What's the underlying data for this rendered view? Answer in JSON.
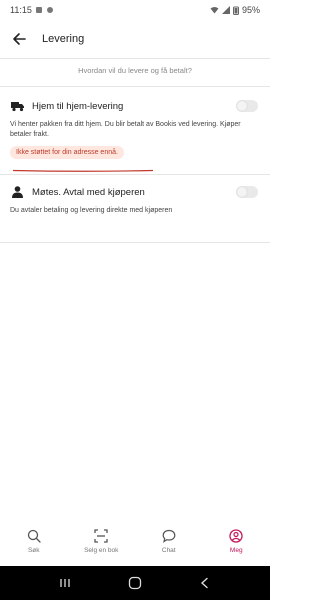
{
  "status_bar": {
    "time": "11:15",
    "battery": "95%"
  },
  "app_bar": {
    "title": "Levering"
  },
  "question": "Hvordan vil du levere og få betalt?",
  "options": [
    {
      "title": "Hjem til hjem-levering",
      "description": "Vi henter pakken fra ditt hjem. Du blir betalt av Bookis ved levering. Kjøper betaler frakt.",
      "warning": "Ikke støttet for din adresse ennå.",
      "toggle_on": false,
      "icon": "truck-icon"
    },
    {
      "title": "Møtes. Avtal med kjøperen",
      "description": "Du avtaler betaling og levering direkte med kjøperen",
      "toggle_on": false,
      "icon": "person-icon"
    }
  ],
  "bottom_nav": [
    {
      "label": "Søk",
      "icon": "search-icon",
      "active": false
    },
    {
      "label": "Selg en bok",
      "icon": "scan-icon",
      "active": false
    },
    {
      "label": "Chat",
      "icon": "chat-icon",
      "active": false
    },
    {
      "label": "Meg",
      "icon": "profile-icon",
      "active": true
    }
  ],
  "colors": {
    "accent": "#c2185b",
    "warning_bg": "#fde7de",
    "warning_text": "#c0392b"
  }
}
